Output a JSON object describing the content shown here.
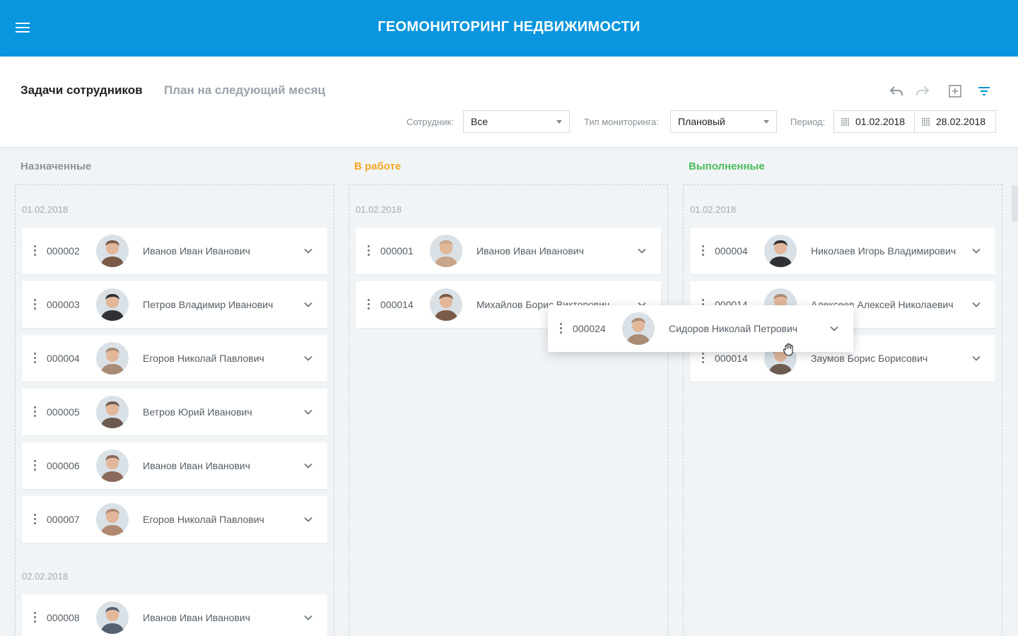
{
  "header": {
    "title": "ГЕОМОНИТОРИНГ НЕДВИЖИМОСТИ",
    "menu_icon": "hamburger-menu-icon",
    "accent_color": "#0a95df"
  },
  "toolbar": {
    "tab_active": "Задачи сотрудников",
    "tab_inactive": "План на следующий месяц",
    "icons": [
      "undo-icon",
      "redo-icon",
      "add-box-icon",
      "filter-icon"
    ],
    "employee_label": "Сотрудник:",
    "employee_value": "Все",
    "type_label": "Тип мониторинга:",
    "type_value": "Плановый",
    "period_label": "Период:",
    "period_from": "01.02.2018",
    "period_to": "28.02.2018"
  },
  "columns": [
    {
      "title": "Назначенные",
      "color": "#8c949b",
      "groups": [
        {
          "date": "01.02.2018",
          "cards": [
            {
              "num": "000002",
              "name": "Иванов Иван Иванович"
            },
            {
              "num": "000003",
              "name": "Петров Владимир Иванович"
            },
            {
              "num": "000004",
              "name": "Егоров Николай Павлович"
            },
            {
              "num": "000005",
              "name": "Ветров Юрий Иванович"
            },
            {
              "num": "000006",
              "name": "Иванов Иван Иванович"
            },
            {
              "num": "000007",
              "name": "Егоров Николай Павлович"
            }
          ]
        },
        {
          "date": "02.02.2018",
          "cards": [
            {
              "num": "000008",
              "name": "Иванов Иван Иванович"
            }
          ]
        }
      ]
    },
    {
      "title": "В работе",
      "color": "#f5a623",
      "groups": [
        {
          "date": "01.02.2018",
          "cards": [
            {
              "num": "000001",
              "name": "Иванов Иван Иванович"
            },
            {
              "num": "000014",
              "name": "Михайлов Борис Викторович"
            }
          ]
        }
      ]
    },
    {
      "title": "Выполненные",
      "color": "#4cbb5a",
      "groups": [
        {
          "date": "01.02.2018",
          "cards": [
            {
              "num": "000004",
              "name": "Николаев Игорь Владимирович"
            },
            {
              "num": "000014",
              "name": "Алексеев Алексей Николаевич"
            },
            {
              "num": "000014",
              "name": "Заумов Борис Борисович"
            }
          ]
        }
      ]
    }
  ],
  "dragging_card": {
    "num": "000024",
    "name": "Сидоров Николай Петрович"
  }
}
